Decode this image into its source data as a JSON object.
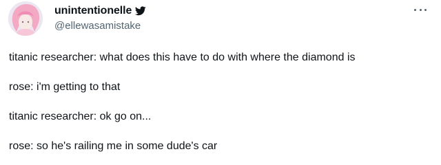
{
  "tweet": {
    "display_name": "unintentionelle",
    "handle": "@ellewasamistake",
    "icons": {
      "avatar": "avatar-image",
      "platform": "twitter-bird-icon",
      "more": "more-options-icon"
    },
    "lines": [
      "titanic researcher: what does this have to do with where the diamond is",
      "rose: i'm getting to that",
      "titanic researcher: ok go on...",
      "rose: so he's railing me in some dude's car"
    ]
  },
  "colors": {
    "text": "#0f1419",
    "secondary": "#536471",
    "background": "#ffffff"
  }
}
